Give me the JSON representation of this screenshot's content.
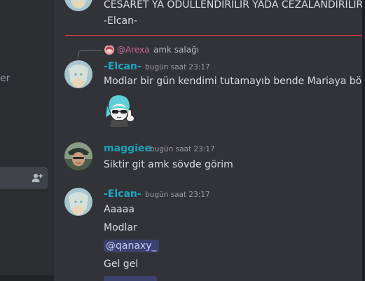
{
  "sidebar": {
    "partial_text": "er"
  },
  "messages": {
    "top_line": "CESARET YA ODULLENDIRILIR YADA CEZALANDIRILIR",
    "top_signature": "-Elcan-",
    "reply": {
      "name": "@Arexa",
      "text": "amk salağı"
    },
    "msg1": {
      "username": "-Elcan-",
      "timestamp": "bugün saat 23:17",
      "text": "Modlar bir gün kendimi tutamayıb bende Mariaya böyle"
    },
    "msg2": {
      "username": "maggiee",
      "timestamp": "bugün saat 23:17",
      "text": "Siktir git amk sövde görim"
    },
    "msg3": {
      "username": "-Elcan-",
      "timestamp": "bugün saat 23:17",
      "lines": [
        "Aaaaa",
        "Modlar",
        "@qanaxy_",
        "Gel gel"
      ]
    }
  },
  "icons": {
    "add_user": "add-user-icon",
    "sticker": "sticker-image"
  },
  "colors": {
    "background": "#313338",
    "sidebar": "#2b2d31",
    "username": "#1fa6c5",
    "divider": "#d94043",
    "mention_bg": "#3c4270"
  }
}
